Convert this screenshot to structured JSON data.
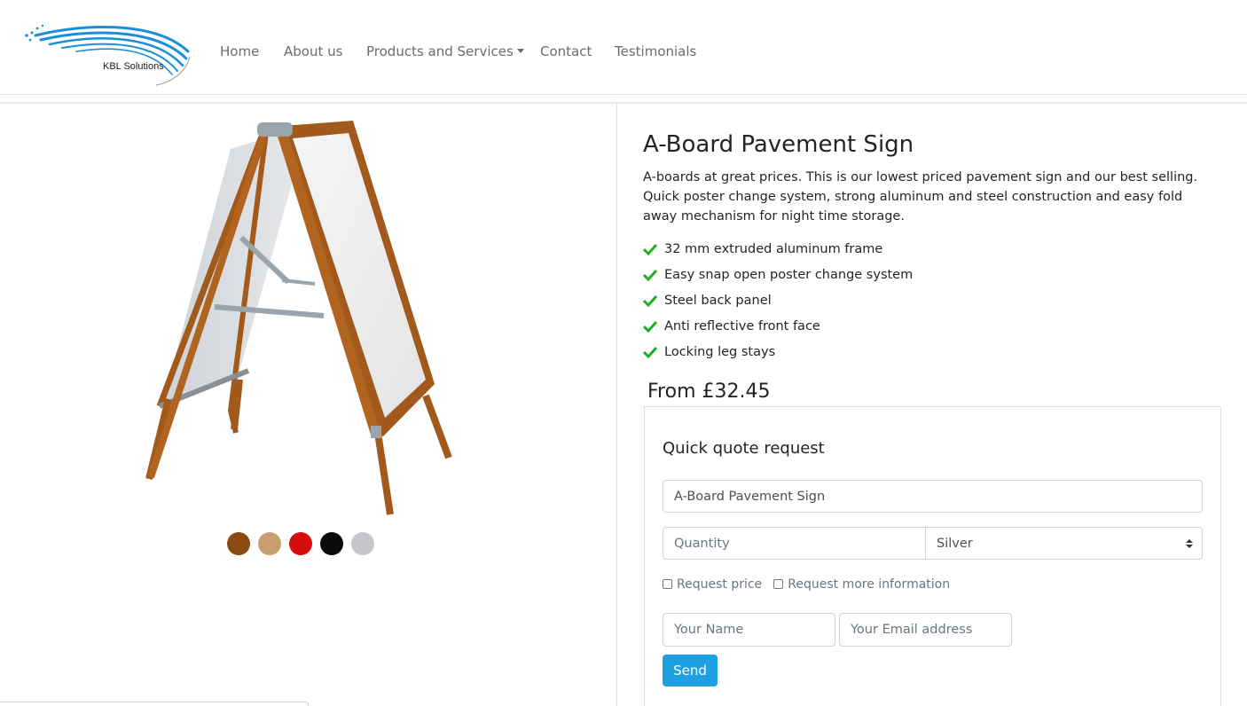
{
  "brand": {
    "logo_text": "KBL Solutions",
    "accent": "#1a8fd9"
  },
  "nav": {
    "items": [
      {
        "label": "Home"
      },
      {
        "label": "About us"
      },
      {
        "label": "Products and Services",
        "dropdown": true
      },
      {
        "label": "Contact"
      },
      {
        "label": "Testimonials"
      }
    ]
  },
  "product": {
    "title": "A-Board Pavement Sign",
    "description": "A-boards at great prices. This is our lowest priced pavement sign and our best selling. Quick poster change system, strong aluminum and steel construction and easy fold away mechanism for night time storage.",
    "features": [
      "32 mm extruded aluminum frame",
      "Easy snap open poster change system",
      "Steel back panel",
      "Anti reflective front face",
      "Locking leg stays"
    ],
    "price": "From £32.45",
    "swatches": [
      "#8b4a12",
      "#c79f6e",
      "#d60d0d",
      "#0b0b0b",
      "#c6c6cb"
    ],
    "check_color": "#1fb01f"
  },
  "quote": {
    "title": "Quick quote request",
    "product_value": "A-Board Pavement Sign",
    "quantity_placeholder": "Quantity",
    "color_selected": "Silver",
    "request_price_label": "Request price",
    "request_info_label": "Request more information",
    "name_placeholder": "Your Name",
    "email_placeholder": "Your Email address",
    "send_label": "Send",
    "button_color": "#1da1e2"
  }
}
